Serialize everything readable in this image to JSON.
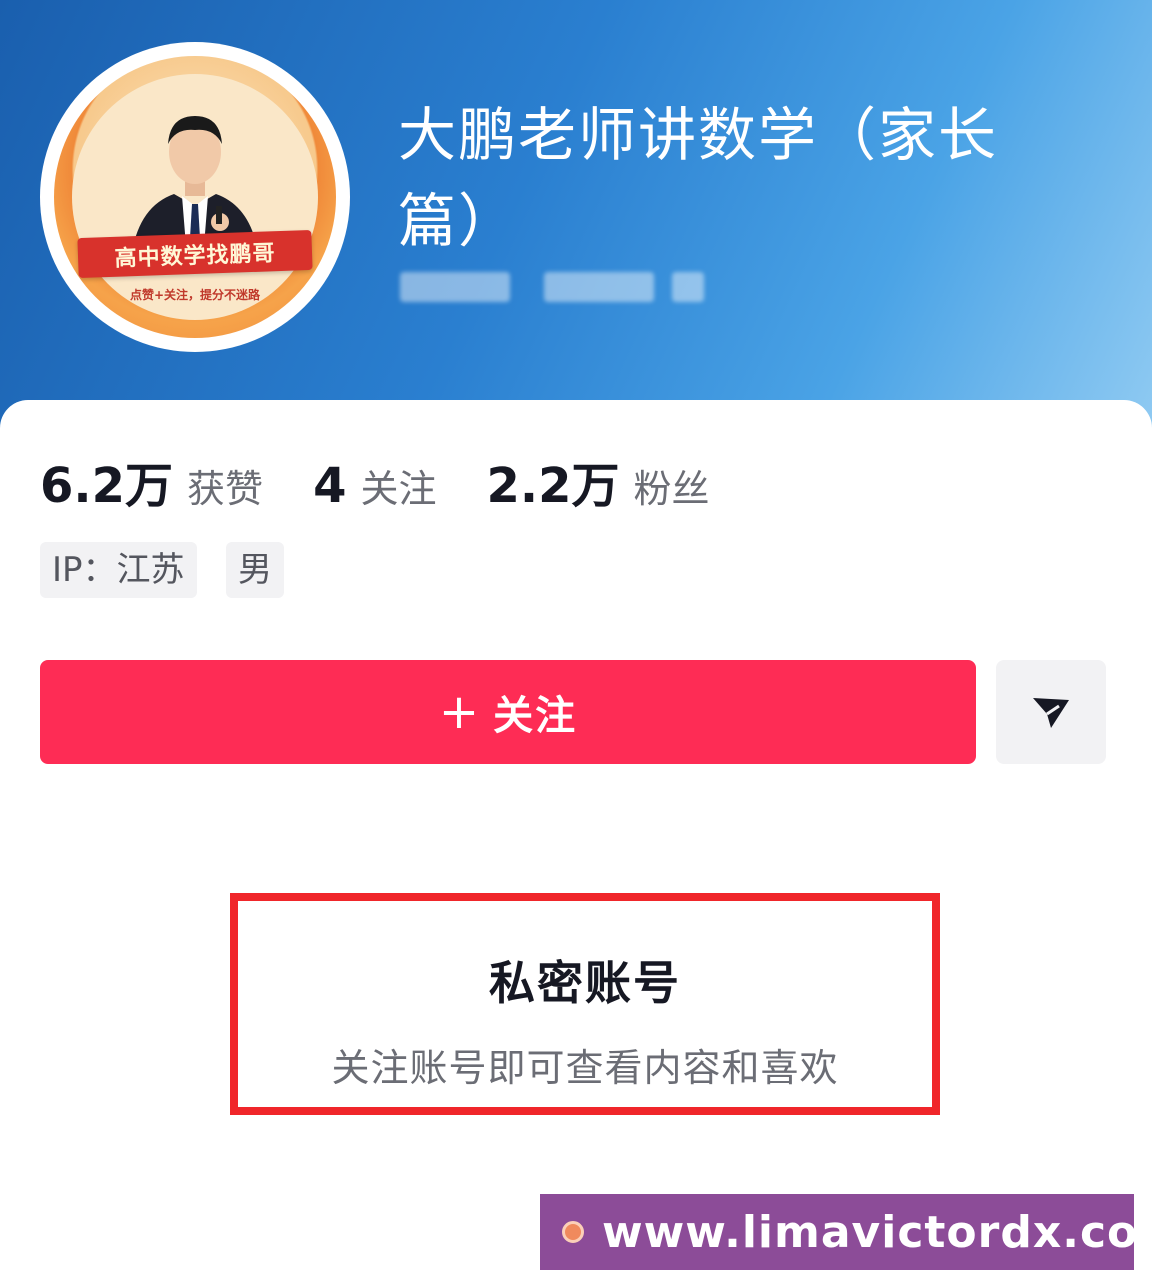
{
  "profile": {
    "title": "大鹏老师讲数学（家长篇）",
    "avatar": {
      "banner_text": "高中数学找鹏哥",
      "tag_text": "点赞+关注，提分不迷路"
    }
  },
  "stats": [
    {
      "value": "6.2万",
      "label": "获赞"
    },
    {
      "value": "4",
      "label": "关注"
    },
    {
      "value": "2.2万",
      "label": "粉丝"
    }
  ],
  "tags": [
    {
      "text": "IP：江苏"
    },
    {
      "text": "男"
    }
  ],
  "actions": {
    "follow_plus": "+",
    "follow_label": "关注",
    "share_icon": "send-icon"
  },
  "private_notice": {
    "title": "私密账号",
    "subtitle": "关注账号即可查看内容和喜欢"
  },
  "watermark": {
    "text": "www.limavictordx.com"
  },
  "colors": {
    "follow_button": "#fe2c55",
    "highlight_border": "#f0262a",
    "watermark_bg": "#8c4c98",
    "header_blue": "#2a7fd0"
  }
}
